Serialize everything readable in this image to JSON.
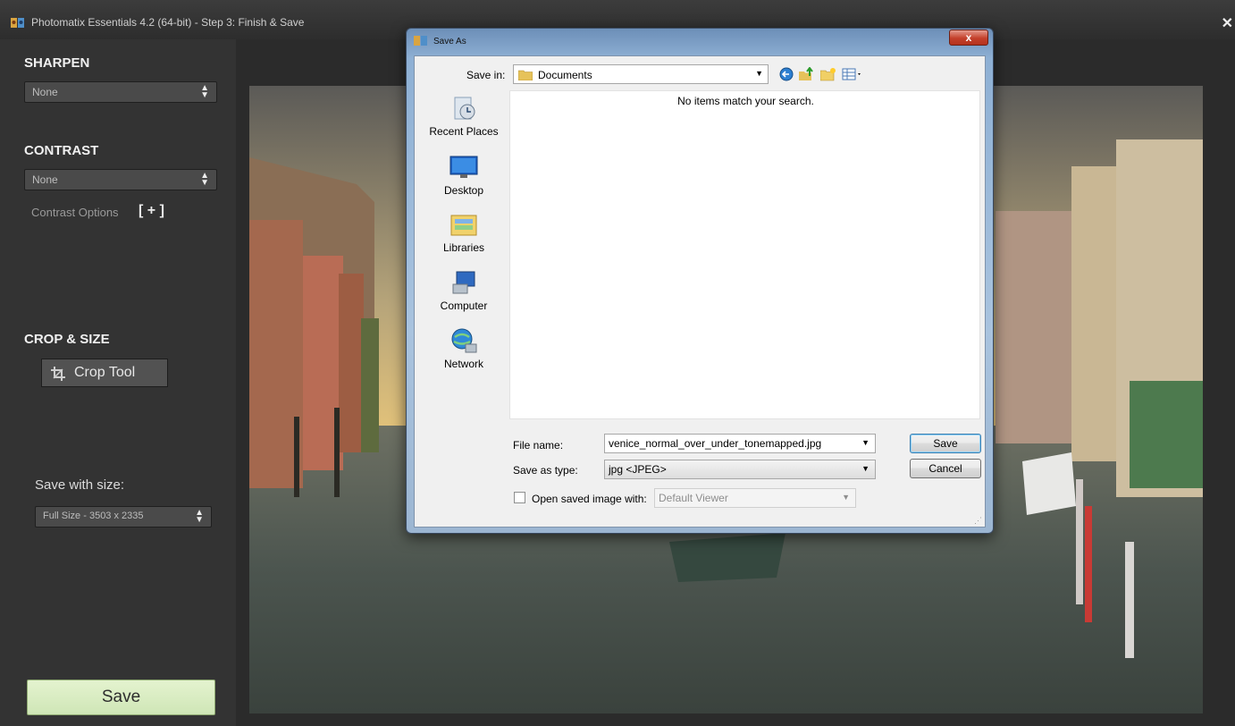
{
  "window": {
    "title": "Photomatix Essentials 4.2 (64-bit) - Step 3: Finish & Save",
    "close_label": "✕"
  },
  "sidebar": {
    "sharpen": {
      "title": "SHARPEN",
      "value": "None"
    },
    "contrast": {
      "title": "CONTRAST",
      "value": "None",
      "options_label": "Contrast Options",
      "options_toggle": "[ + ]"
    },
    "crop": {
      "title": "CROP & SIZE",
      "button_label": "Crop Tool"
    },
    "save_size": {
      "label": "Save with size:",
      "value": "Full Size - 3503 x 2335"
    },
    "save_button": "Save"
  },
  "dialog": {
    "title": "Save As",
    "close_label": "x",
    "save_in": {
      "label": "Save in:",
      "value": "Documents"
    },
    "toolbar_icons": [
      "back-icon",
      "up-folder-icon",
      "new-folder-icon",
      "view-menu-icon"
    ],
    "places": [
      {
        "label": "Recent Places",
        "icon": "recent-places-icon"
      },
      {
        "label": "Desktop",
        "icon": "desktop-icon"
      },
      {
        "label": "Libraries",
        "icon": "libraries-icon"
      },
      {
        "label": "Computer",
        "icon": "computer-icon"
      },
      {
        "label": "Network",
        "icon": "network-icon"
      }
    ],
    "file_list_message": "No items match your search.",
    "file_name": {
      "label": "File name:",
      "value": "venice_normal_over_under_tonemapped.jpg"
    },
    "save_as_type": {
      "label": "Save as type:",
      "value": "jpg <JPEG>"
    },
    "open_with": {
      "label": "Open saved image with:",
      "value": "Default Viewer",
      "checked": false
    },
    "save_button": "Save",
    "cancel_button": "Cancel"
  },
  "colors": {
    "sidebar_bg": "#333333",
    "save_button_bg": "#d8ecc0",
    "dialog_frame": "#8eb0d4",
    "dialog_close": "#c4402b"
  }
}
